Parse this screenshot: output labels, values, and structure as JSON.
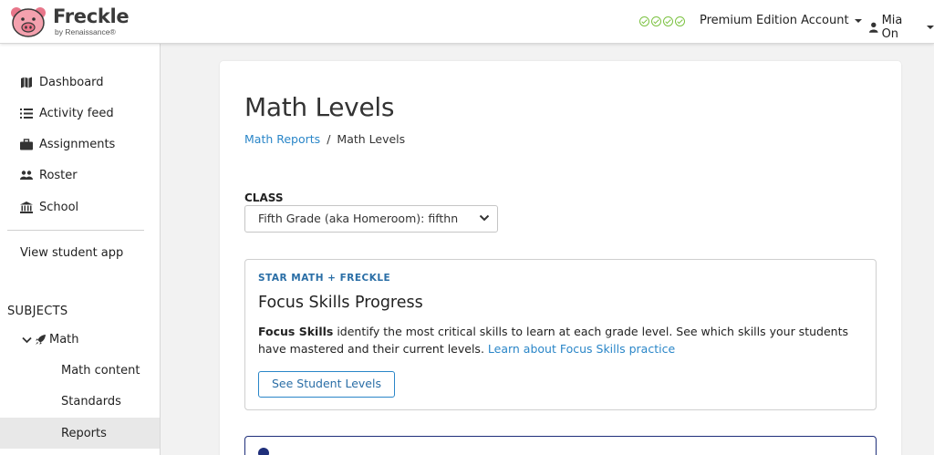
{
  "header": {
    "logo_title": "Freckle",
    "logo_subtitle": "by Renaissance®",
    "status_checks": 4,
    "account_label": "Premium Edition Account",
    "user_name": "Mia On",
    "check_color": "#7cc242"
  },
  "sidebar": {
    "items": [
      {
        "label": "Dashboard",
        "icon": "map-icon"
      },
      {
        "label": "Activity feed",
        "icon": "list-icon"
      },
      {
        "label": "Assignments",
        "icon": "briefcase-icon"
      },
      {
        "label": "Roster",
        "icon": "users-icon"
      },
      {
        "label": "School",
        "icon": "institution-icon"
      }
    ],
    "view_student_app": "View student app",
    "subjects_heading": "SUBJECTS",
    "math_label": "Math",
    "math_subitems": [
      "Math content",
      "Standards",
      "Reports"
    ]
  },
  "main": {
    "page_title": "Math Levels",
    "breadcrumb": {
      "parent": "Math Reports",
      "separator": "/",
      "current": "Math Levels"
    },
    "class_label": "CLASS",
    "class_selected": "Fifth Grade (aka Homeroom): fifthn",
    "focus_box": {
      "eyebrow": "STAR MATH + FRECKLE",
      "title": "Focus Skills Progress",
      "desc_bold": "Focus Skills",
      "desc_text": " identify the most critical skills to learn at each grade level. See which skills your students have mastered and their current levels. ",
      "learn_link": "Learn about Focus Skills practice",
      "button_label": "See Student Levels"
    }
  },
  "colors": {
    "link": "#2a86c8",
    "accent_dark": "#1f2f7a",
    "pig_pink": "#f08a9a"
  }
}
